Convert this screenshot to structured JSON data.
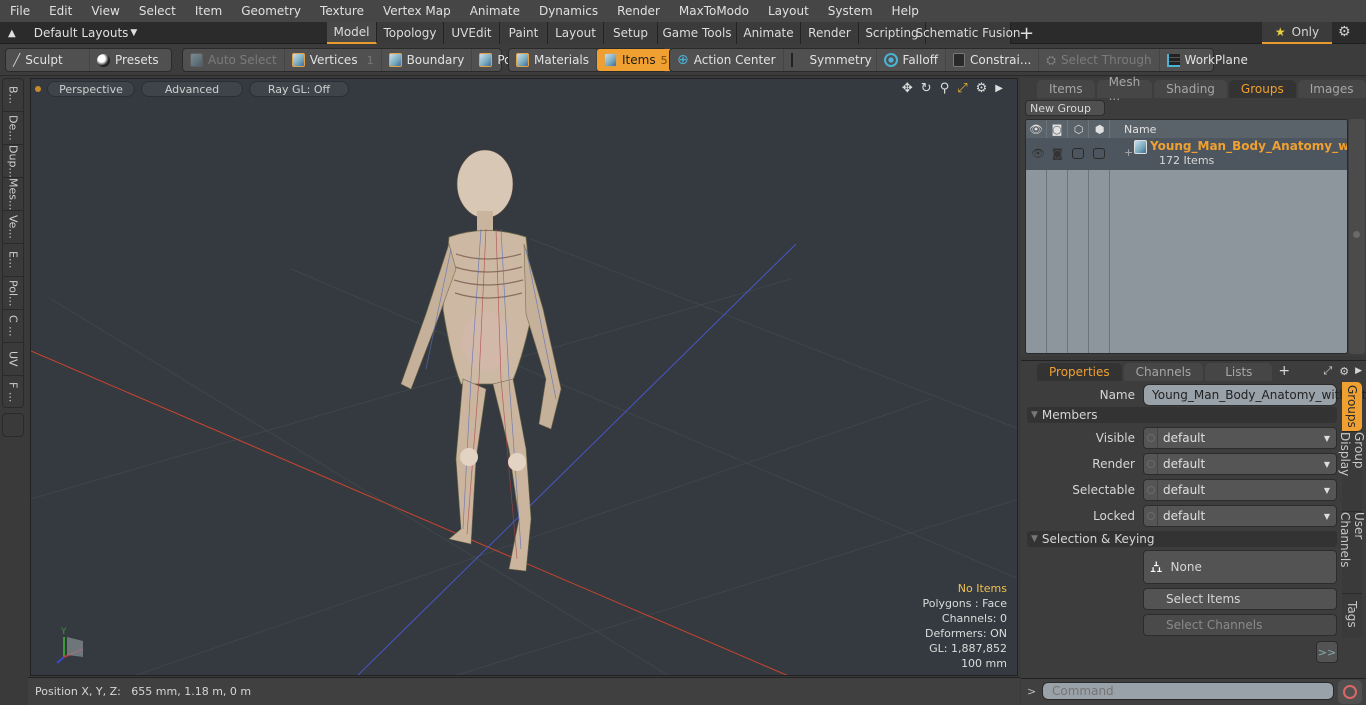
{
  "menu": [
    "File",
    "Edit",
    "View",
    "Select",
    "Item",
    "Geometry",
    "Texture",
    "Vertex Map",
    "Animate",
    "Dynamics",
    "Render",
    "MaxToModo",
    "Layout",
    "System",
    "Help"
  ],
  "layout_bar": {
    "layouts_dropdown": "Default Layouts",
    "tabs": [
      "Model",
      "Topology",
      "UVEdit",
      "Paint",
      "Layout",
      "Setup",
      "Game Tools",
      "Animate",
      "Render",
      "Scripting",
      "Schematic Fusion"
    ],
    "active_tab": "Model",
    "add_tab": "+",
    "only_label": "Only"
  },
  "toolbar": {
    "sculpt": "Sculpt",
    "presets": "Presets",
    "auto_select": "Auto Select",
    "vertices": "Vertices",
    "vertices_count": "1",
    "boundary": "Boundary",
    "polygons": "Polygons",
    "materials": "Materials",
    "items": "Items",
    "items_count": "5",
    "action_center": "Action Center",
    "symmetry": "Symmetry",
    "falloff": "Falloff",
    "constraints": "Constrai...",
    "select_through": "Select Through",
    "workplane": "WorkPlane"
  },
  "left_tabs": [
    "B...",
    "De...",
    "Dup...",
    "Mes...",
    "Ve...",
    "E...",
    "Pol...",
    "C ...",
    "UV",
    "F ..."
  ],
  "viewport": {
    "view_mode": "Perspective",
    "shading": "Advanced",
    "raygl": "Ray GL: Off",
    "info": {
      "selection": "No Items",
      "polygons": "Polygons : Face",
      "channels": "Channels: 0",
      "deformers": "Deformers: ON",
      "gl": "GL: 1,887,852",
      "scale": "100 mm"
    },
    "axis_labels": {
      "y": "Y"
    }
  },
  "status": {
    "position": "Position X, Y, Z:   655 mm, 1.18 m, 0 m"
  },
  "groups_panel": {
    "tabs": [
      "Items",
      "Mesh ...",
      "Shading",
      "Groups",
      "Images"
    ],
    "active_tab": "Groups",
    "new_group": "New Group",
    "column_name": "Name",
    "group": {
      "name": "Young_Man_Body_Anatomy_wi ...",
      "count": "172 Items"
    }
  },
  "properties_panel": {
    "tabs": [
      "Properties",
      "Channels",
      "Lists"
    ],
    "active_tab": "Properties",
    "name_label": "Name",
    "name_value": "Young_Man_Body_Anatomy_without_",
    "members_section": "Members",
    "fields": [
      {
        "label": "Visible",
        "value": "default"
      },
      {
        "label": "Render",
        "value": "default"
      },
      {
        "label": "Selectable",
        "value": "default"
      },
      {
        "label": "Locked",
        "value": "default"
      }
    ],
    "selection_section": "Selection & Keying",
    "none_label": "None",
    "select_items": "Select Items",
    "select_channels": "Select Channels",
    "more": ">>",
    "side_tabs": [
      "Groups",
      "Group Display",
      "User Channels",
      "Tags"
    ],
    "active_side_tab": "Groups"
  },
  "command": {
    "prompt": ">",
    "placeholder": "Command"
  },
  "colors": {
    "accent": "#f0a030",
    "viewport_bg": "#343a3f",
    "x_axis": "#d0452f",
    "z_axis": "#4a55c8"
  }
}
